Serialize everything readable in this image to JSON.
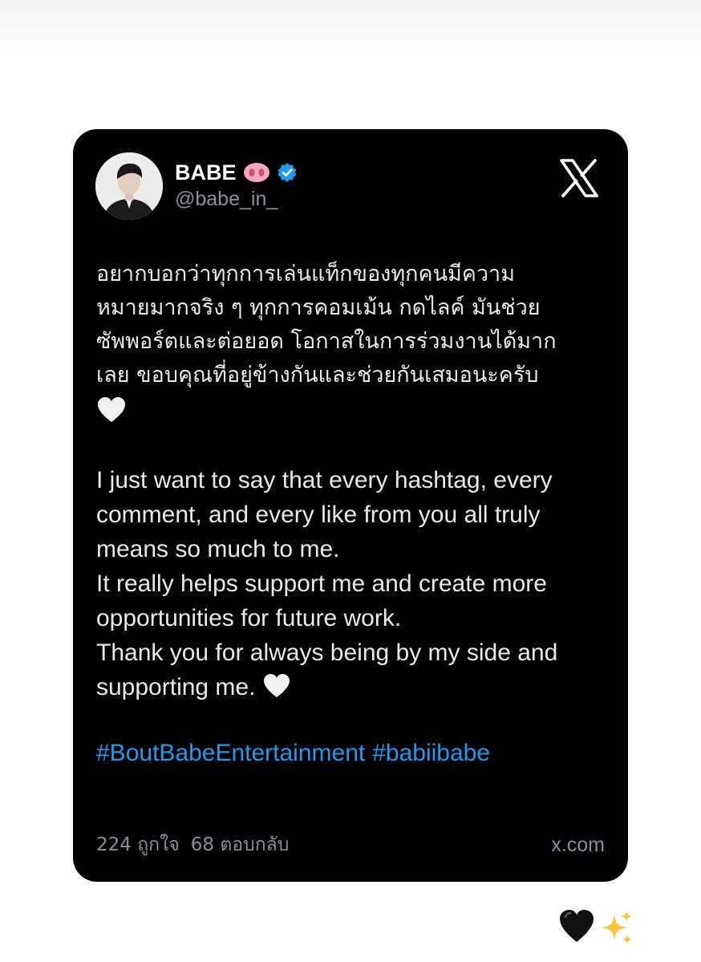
{
  "post": {
    "display_name": "BABE",
    "name_emoji": "pig-nose-emoji",
    "verified_icon": "verified-badge-icon",
    "handle": "@babe_in_",
    "platform_logo": "x-logo-icon",
    "thai_text": "อยากบอกว่าทุกการเล่นแท็กของทุกคนมีความ\nหมายมากจริง ๆ ทุกการคอมเม้น กดไลค์ มันช่วย\nซัพพอร์ตและต่อยอด โอกาสในการร่วมงานได้มาก\nเลย ขอบคุณที่อยู่ข้างกันและช่วยกันเสมอนะครับ",
    "thai_trailing_emoji": "white-heart-emoji",
    "english_text": "I just want to say that every hashtag, every\ncomment, and every like from you all truly\nmeans so much to me.\nIt really helps support me and create more\nopportunities for future work.\nThank you for always being by my side and\nsupporting me.",
    "english_trailing_emoji": "white-heart-emoji",
    "hashtags": [
      "#BoutBabeEntertainment",
      "#babiibabe"
    ],
    "likes": "224 ถูกใจ",
    "replies": "68 ตอบกลับ",
    "domain": "x.com"
  },
  "story_stickers": {
    "emoji_1": "black-heart-emoji",
    "emoji_2": "sparkles-emoji"
  },
  "colors": {
    "background": "#ffffff",
    "card": "#000000",
    "primary_text": "#e7e9ea",
    "secondary_text": "#8b8f94",
    "hashtag": "#1d9bf0",
    "verified": "#1d9bf0",
    "pig": "#f7a8bc"
  }
}
